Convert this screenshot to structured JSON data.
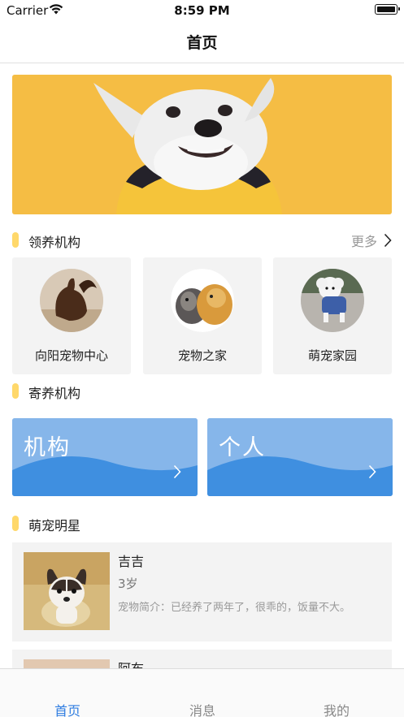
{
  "status_bar": {
    "carrier": "Carrier",
    "time": "8:59 PM"
  },
  "nav": {
    "title": "首页"
  },
  "banner": {
    "subject": "dog-photo"
  },
  "adoption": {
    "title": "领养机构",
    "more_label": "更多",
    "orgs": [
      {
        "name": "向阳宠物中心",
        "photo": "squirrel-photo"
      },
      {
        "name": "宠物之家",
        "photo": "guinea-pigs-photo"
      },
      {
        "name": "萌宠家园",
        "photo": "poodle-photo"
      }
    ]
  },
  "foster": {
    "title": "寄养机构",
    "cards": [
      {
        "label": "机构"
      },
      {
        "label": "个人"
      }
    ]
  },
  "pet_star": {
    "title": "萌宠明星",
    "pets": [
      {
        "name": "吉吉",
        "age": "3岁",
        "desc": "宠物简介：已经养了两年了，很乖的，饭量不大。"
      },
      {
        "name": "阿布",
        "age": "",
        "desc": ""
      }
    ]
  },
  "tabs": [
    {
      "label": "首页",
      "active": true
    },
    {
      "label": "消息",
      "active": false
    },
    {
      "label": "我的",
      "active": false
    }
  ],
  "colors": {
    "accent": "#2f7de1",
    "section_bar": "#ffd86a",
    "card_bg": "#f3f3f3",
    "banner_bg": "#f4b83a",
    "foster_wave_dark": "#3f8fe0",
    "foster_wave_light": "#86b6ea"
  }
}
